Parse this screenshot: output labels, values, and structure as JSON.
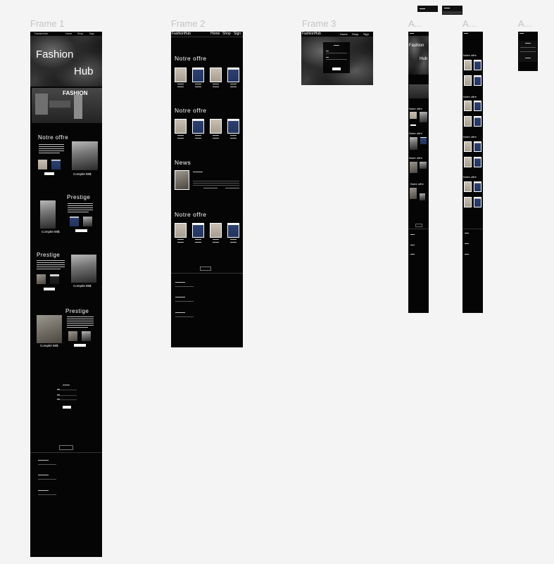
{
  "frames": {
    "f1": {
      "label": "Frame 1"
    },
    "f2": {
      "label": "Frame 2"
    },
    "f3": {
      "label": "Frame 3"
    },
    "f4": {
      "label": "A..."
    },
    "f5": {
      "label": "A..."
    },
    "f6": {
      "label": "A..."
    }
  },
  "frame1": {
    "nav": {
      "brand": "FashionHub",
      "links": [
        "Home",
        "Shop",
        "Sign"
      ]
    },
    "hero": {
      "line1": "Fashion",
      "line2": "Hub"
    },
    "banner": {
      "text": "FASHION"
    },
    "sections": [
      {
        "title": "Notre offre",
        "caption": "Complet 98$"
      },
      {
        "title": "Prestige",
        "caption": "Complet 98$"
      },
      {
        "title": "Prestige",
        "caption": "Complet 98$"
      },
      {
        "title": "Prestige",
        "caption": "Complet 98$"
      }
    ]
  },
  "frame2": {
    "nav": {
      "brand": "FashionHub",
      "links": [
        "Home",
        "Shop",
        "Sign"
      ]
    },
    "sections": [
      {
        "title": "Notre offre"
      },
      {
        "title": "Notre offre"
      },
      {
        "title": "News"
      },
      {
        "title": "Notre offre"
      }
    ]
  },
  "frame3": {
    "nav": {
      "brand": "FashionHub",
      "links": [
        "Home",
        "Shop",
        "Sign"
      ]
    }
  },
  "frame4": {
    "hero": {
      "line1": "Fashion",
      "line2": "Hub"
    },
    "sections": [
      "Notre offre",
      "Notre offre",
      "Notre offre",
      "Notre offre"
    ]
  },
  "frame5": {
    "sections": [
      "Notre offre",
      "Notre offre",
      "Notre offre",
      "Notre offre"
    ]
  },
  "colors": {
    "canvas": "#f4f4f4",
    "frame": "#050505",
    "label": "#c3c3c3"
  }
}
